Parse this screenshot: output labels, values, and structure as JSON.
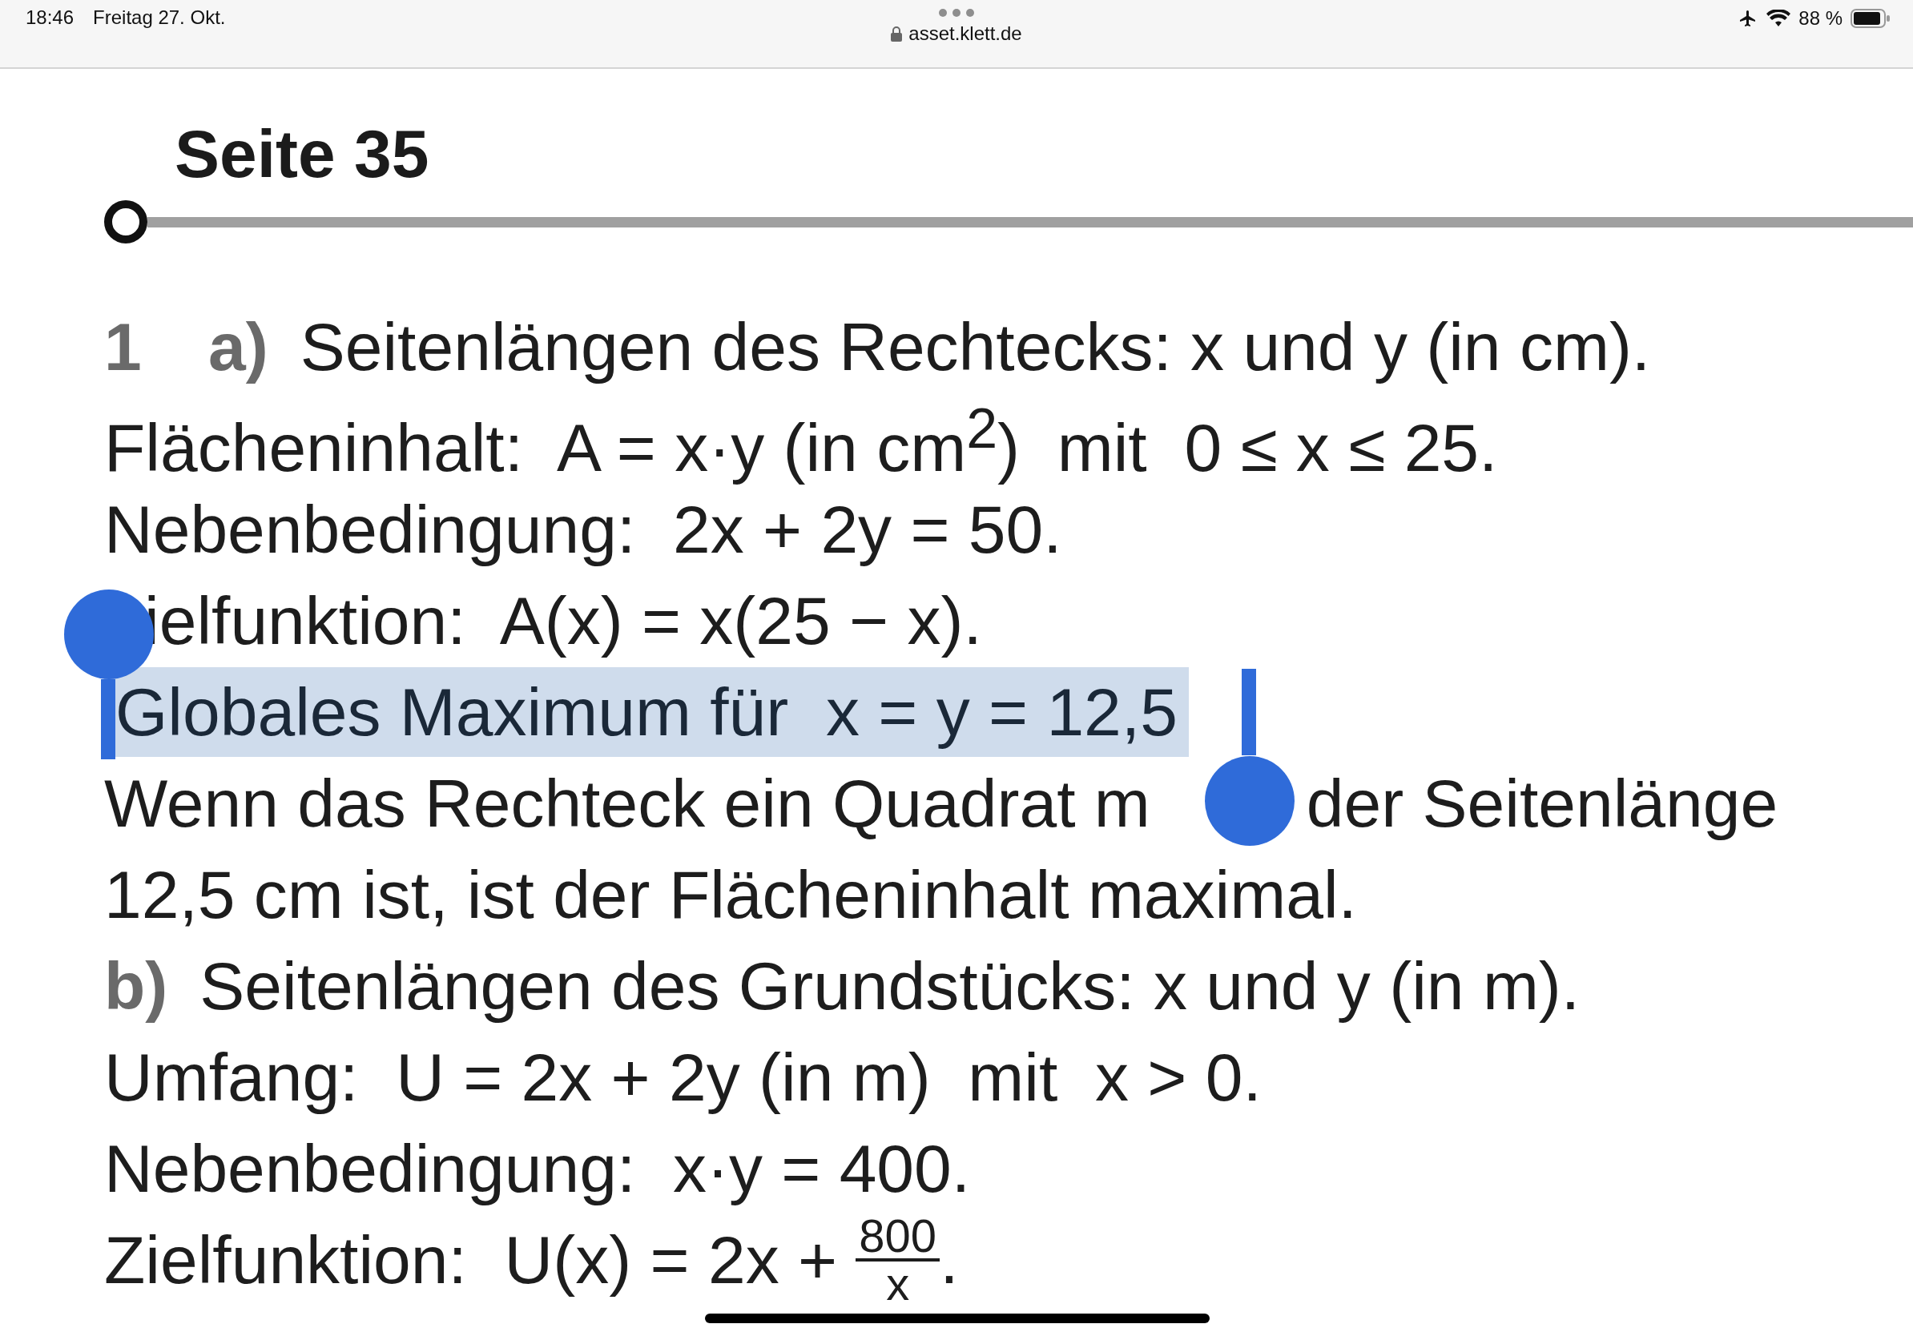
{
  "status_bar": {
    "time": "18:46",
    "date": "Freitag 27. Okt.",
    "url": "asset.klett.de",
    "battery": "88 %"
  },
  "heading": "Seite 35",
  "lines": [
    {
      "number": "1",
      "label": "a)",
      "segments": [
        "Seitenlängen des Rechtecks: x und y (in cm)."
      ],
      "selected": false
    },
    {
      "segments": [
        "Flächeninhalt:  A = x·y (in cm$^{2}$)  mit  0 ≤ x ≤ 25."
      ],
      "selected": false
    },
    {
      "segments": [
        "Nebenbedingung:  2x + 2y = 50."
      ],
      "selected": false
    },
    {
      "kind": "after-handle",
      "segments": [
        "ielfunktion:  A(x) = x(25 − x)."
      ],
      "selected": false
    },
    {
      "segments": [
        "Globales Maximum für  x = y = 12,5"
      ],
      "selected": true
    },
    {
      "kind": "split",
      "segments": [
        "Wenn das Rechteck ein Quadrat m",
        "der Seitenlänge"
      ],
      "selected": false
    },
    {
      "segments": [
        "12,5 cm ist, ist der Flächeninhalt maximal."
      ],
      "selected": false
    },
    {
      "label": "b)",
      "segments": [
        "Seitenlängen des Grundstücks: x und y (in m)."
      ],
      "selected": false
    },
    {
      "segments": [
        "Umfang:  U = 2x + 2y (in m)  mit  x > 0."
      ],
      "selected": false
    },
    {
      "segments": [
        "Nebenbedingung:  x·y = 400."
      ],
      "selected": false
    },
    {
      "segments": [
        "Zielfunktion:  U(x) = 2x + "
      ],
      "fraction": {
        "numerator": "800",
        "denominator": "x"
      },
      "tail": ".",
      "selected": false
    }
  ]
}
